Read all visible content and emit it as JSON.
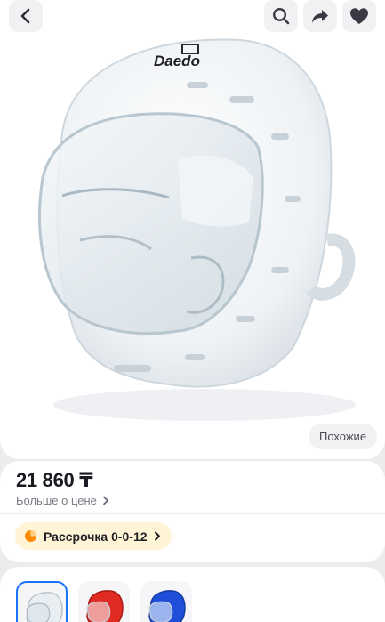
{
  "header": {
    "back_icon": "chevron-left-icon",
    "search_icon": "search-icon",
    "share_icon": "share-arrow-icon",
    "favorite_icon": "heart-icon"
  },
  "product_image": {
    "brand_logo": "Daedo",
    "similar_label": "Похожие"
  },
  "price": {
    "amount": "21 860 ₸",
    "more_link": "Больше о цене",
    "more_icon": "chevron-right-icon"
  },
  "installment": {
    "label": "Рассрочка 0-0-12",
    "icon": "pie-chart-icon",
    "chevron_icon": "chevron-right-icon"
  },
  "variants": {
    "items": [
      {
        "color_name": "white",
        "color": "#e8eef2",
        "selected": true
      },
      {
        "color_name": "red",
        "color": "#e12a22",
        "selected": false
      },
      {
        "color_name": "blue",
        "color": "#1f4fd8",
        "selected": false
      }
    ]
  },
  "colors": {
    "accent_blue": "#1a73ff",
    "installment_bg": "#fff4d6",
    "installment_icon": "#ff8a00"
  }
}
